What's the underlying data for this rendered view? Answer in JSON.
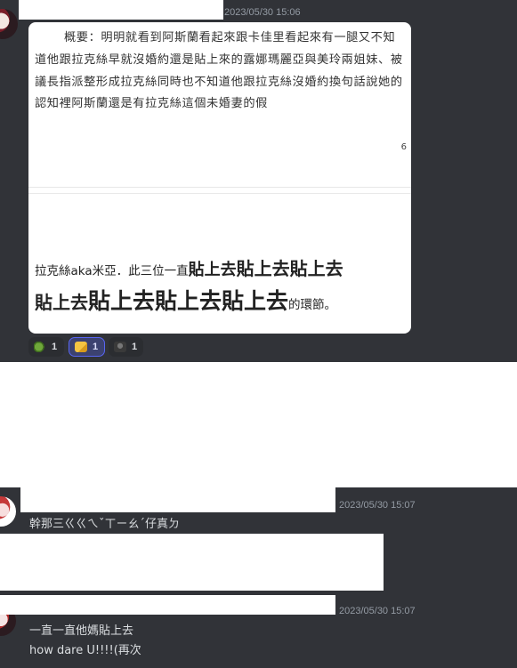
{
  "message_1": {
    "timestamp": "2023/05/30 15:06",
    "image_card": {
      "summary": "概要：明明就看到阿斯蘭看起來跟卡佳里看起來有一腿又不知道他跟拉克絲早就沒婚約還是貼上來的露娜瑪麗亞與美玲兩姐妹、被議長指派整形成拉克絲同時也不知道他跟拉克絲沒婚約換句話說她的認知裡阿斯蘭還是有拉克絲這個未婚妻的假",
      "page_number": "6",
      "quote": {
        "line1_intro": "拉克絲aka米亞．此三位一直",
        "line1_a": "貼上去",
        "line1_b": "貼上去貼上去",
        "line2_a": "貼上去",
        "line2_b": "貼上去貼上去貼上去",
        "line2_end": "的環節。"
      }
    },
    "reactions": [
      {
        "icon": "turtle-emoji-icon",
        "count": "1",
        "active": false
      },
      {
        "icon": "cheese-emoji-icon",
        "count": "1",
        "active": true
      },
      {
        "icon": "dark-character-emoji-icon",
        "count": "1",
        "active": false
      }
    ]
  },
  "message_2": {
    "timestamp": "2023/05/30 15:07",
    "text": "幹那三ㄍㄍㄟˇㄒㄧㄠˊ仔真ㄉ"
  },
  "message_3": {
    "timestamp": "2023/05/30 15:07",
    "lines": [
      "一直一直他媽貼上去",
      "how dare U!!!!(再次"
    ]
  },
  "colors": {
    "discord_background": "#313338",
    "text_primary": "#dbdee1",
    "timestamp": "#949ba4",
    "reaction_active_border": "#5865f2"
  }
}
